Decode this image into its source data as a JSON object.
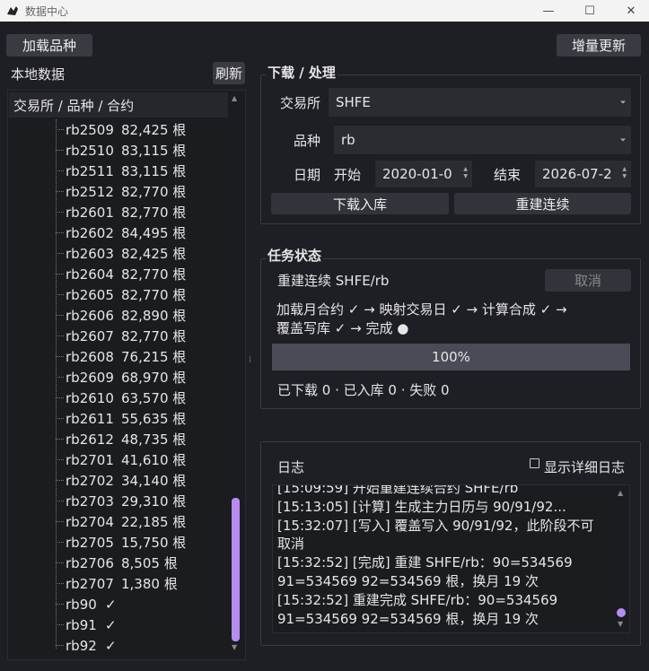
{
  "window": {
    "title": "数据中心",
    "minimize": "—",
    "maximize": "☐",
    "close": "✕"
  },
  "toolbar": {
    "load_button": "加载品种",
    "incremental_button": "增量更新"
  },
  "left": {
    "label": "本地数据",
    "refresh_button": "刷新",
    "tree_header": "交易所 / 品种 / 合约",
    "items": [
      {
        "code": "rb2509",
        "count": "82,425 根"
      },
      {
        "code": "rb2510",
        "count": "83,115 根"
      },
      {
        "code": "rb2511",
        "count": "83,115 根"
      },
      {
        "code": "rb2512",
        "count": "82,770 根"
      },
      {
        "code": "rb2601",
        "count": "82,770 根"
      },
      {
        "code": "rb2602",
        "count": "84,495 根"
      },
      {
        "code": "rb2603",
        "count": "82,425 根"
      },
      {
        "code": "rb2604",
        "count": "82,770 根"
      },
      {
        "code": "rb2605",
        "count": "82,770 根"
      },
      {
        "code": "rb2606",
        "count": "82,890 根"
      },
      {
        "code": "rb2607",
        "count": "82,770 根"
      },
      {
        "code": "rb2608",
        "count": "76,215 根"
      },
      {
        "code": "rb2609",
        "count": "68,970 根"
      },
      {
        "code": "rb2610",
        "count": "63,570 根"
      },
      {
        "code": "rb2611",
        "count": "55,635 根"
      },
      {
        "code": "rb2612",
        "count": "48,735 根"
      },
      {
        "code": "rb2701",
        "count": "41,610 根"
      },
      {
        "code": "rb2702",
        "count": "34,140 根"
      },
      {
        "code": "rb2703",
        "count": "29,310 根"
      },
      {
        "code": "rb2704",
        "count": "22,185 根"
      },
      {
        "code": "rb2705",
        "count": "15,750 根"
      },
      {
        "code": "rb2706",
        "count": "8,505 根"
      },
      {
        "code": "rb2707",
        "count": "1,380 根"
      }
    ],
    "continuous": [
      {
        "code": "rb90",
        "check": "✓"
      },
      {
        "code": "rb91",
        "check": "✓"
      },
      {
        "code": "rb92",
        "check": "✓"
      }
    ]
  },
  "download": {
    "title": "下载 / 处理",
    "exchange_label": "交易所",
    "exchange_value": "SHFE",
    "product_label": "品种",
    "product_value": "rb",
    "date_label": "日期",
    "start_label": "开始",
    "start_value": "2020-01-0",
    "end_label": "结束",
    "end_value": "2026-07-2",
    "download_button": "下载入库",
    "rebuild_button": "重建连续"
  },
  "task": {
    "title": "任务状态",
    "name": "重建连续 SHFE/rb",
    "cancel_button": "取消",
    "steps_line1": "加载月合约 ✓ → 映射交易日 ✓ → 计算合成 ✓ →",
    "steps_line2": "覆盖写库 ✓ → 完成 ●",
    "progress": 100,
    "progress_text": "100%",
    "stats": "已下载 0 · 已入库 0 · 失败 0"
  },
  "log": {
    "title": "日志",
    "detail_checkbox": "显示详细日志",
    "lines": [
      "[15:09:59] 开始重建连续合约 SHFE/rb",
      "[15:13:05] [计算] 生成主力日历与 90/91/92...",
      "[15:32:07] [写入] 覆盖写入 90/91/92，此阶段不可",
      "取消",
      "[15:32:52] [完成] 重建 SHFE/rb：90=534569",
      "91=534569 92=534569 根，换月 19 次",
      "[15:32:52] 重建完成 SHFE/rb：90=534569",
      "91=534569 92=534569 根，换月 19 次"
    ]
  },
  "colors": {
    "background": "#1e1f24",
    "accent": "#b68cf0",
    "button": "#3a3b42",
    "progress": "#4a4b56"
  }
}
